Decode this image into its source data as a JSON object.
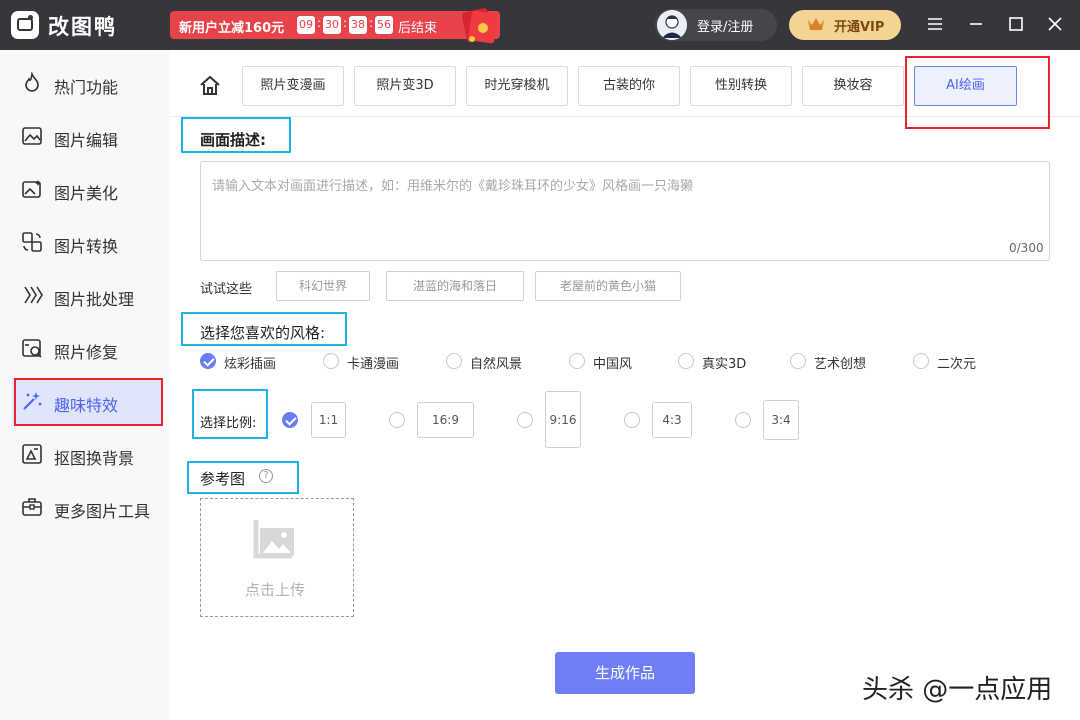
{
  "app": {
    "title": "改图鸭"
  },
  "promo": {
    "text": "新用户立减160元",
    "countdown": [
      "09",
      "30",
      "38",
      "56"
    ],
    "suffix": "后结束"
  },
  "header": {
    "login_label": "登录/注册",
    "vip_label": "开通VIP"
  },
  "sidebar": {
    "items": [
      {
        "label": "热门功能",
        "icon": "flame-icon"
      },
      {
        "label": "图片编辑",
        "icon": "image-edit-icon"
      },
      {
        "label": "图片美化",
        "icon": "image-beautify-icon"
      },
      {
        "label": "图片转换",
        "icon": "image-convert-icon"
      },
      {
        "label": "图片批处理",
        "icon": "batch-icon"
      },
      {
        "label": "照片修复",
        "icon": "photo-repair-icon"
      },
      {
        "label": "趣味特效",
        "icon": "magic-wand-icon",
        "active": true
      },
      {
        "label": "抠图换背景",
        "icon": "cutout-icon"
      },
      {
        "label": "更多图片工具",
        "icon": "toolbox-icon"
      }
    ]
  },
  "tabs": [
    {
      "label": "照片变漫画"
    },
    {
      "label": "照片变3D"
    },
    {
      "label": "时光穿梭机"
    },
    {
      "label": "古装的你"
    },
    {
      "label": "性别转换"
    },
    {
      "label": "换妆容"
    },
    {
      "label": "AI绘画",
      "active": true
    }
  ],
  "description": {
    "title": "画面描述:",
    "placeholder": "请输入文本对画面进行描述，如：用维米尔的《戴珍珠耳环的少女》风格画一只海獭",
    "counter": "0/300",
    "try_label": "试试这些",
    "suggestions": [
      "科幻世界",
      "湛蓝的海和落日",
      "老屋前的黄色小猫"
    ]
  },
  "style": {
    "title": "选择您喜欢的风格:",
    "selected": "炫彩插画",
    "options": [
      "炫彩插画",
      "卡通漫画",
      "自然风景",
      "中国风",
      "真实3D",
      "艺术创想",
      "二次元"
    ]
  },
  "ratio": {
    "title": "选择比例:",
    "selected": "1:1",
    "options": [
      "1:1",
      "16:9",
      "9:16",
      "4:3",
      "3:4"
    ]
  },
  "reference": {
    "title": "参考图",
    "help": "?",
    "upload_label": "点击上传"
  },
  "generate_label": "生成作品",
  "watermark": "头杀 @一点应用",
  "colors": {
    "accent": "#6e7ff6",
    "titlebar": "#36363d",
    "promo": "#e8424a",
    "highlight_red": "#e8232b",
    "highlight_cyan": "#1db4e8"
  }
}
